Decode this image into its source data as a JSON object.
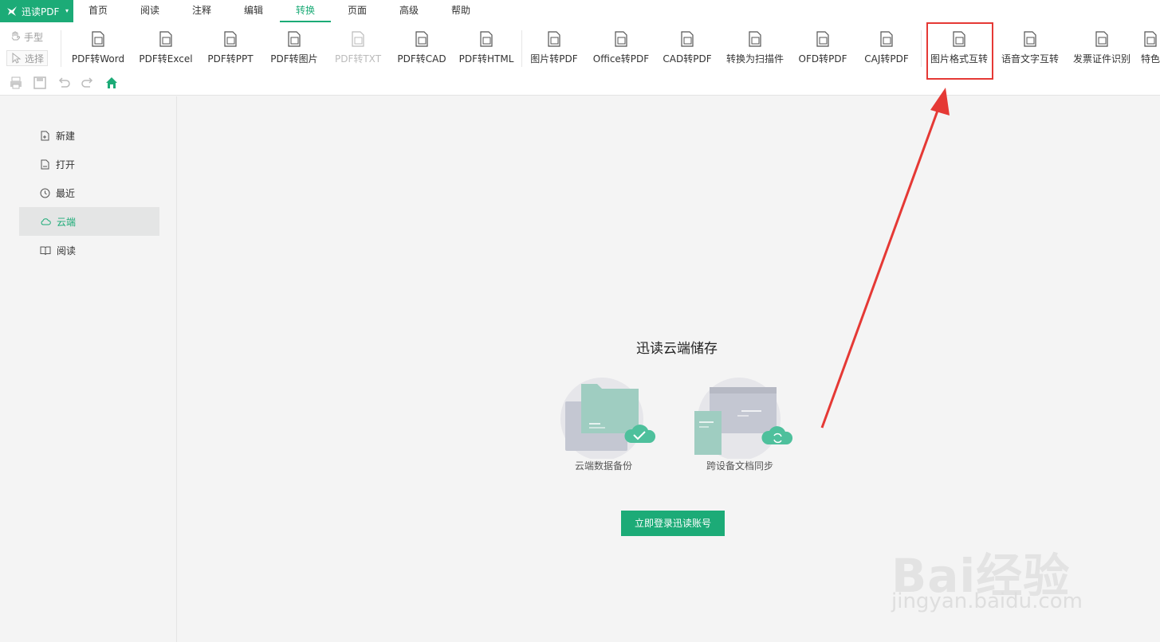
{
  "app": {
    "name": "迅读PDF"
  },
  "menu": [
    {
      "label": "首页"
    },
    {
      "label": "阅读"
    },
    {
      "label": "注释"
    },
    {
      "label": "编辑"
    },
    {
      "label": "转换"
    },
    {
      "label": "页面"
    },
    {
      "label": "高级"
    },
    {
      "label": "帮助"
    }
  ],
  "active_menu": "转换",
  "modes": {
    "hand": "手型",
    "select": "选择"
  },
  "tools": [
    {
      "label": "PDF转Word",
      "icon": "word-icon",
      "enabled": true
    },
    {
      "label": "PDF转Excel",
      "icon": "excel-icon",
      "enabled": true
    },
    {
      "label": "PDF转PPT",
      "icon": "ppt-icon",
      "enabled": true
    },
    {
      "label": "PDF转图片",
      "icon": "image-file-icon",
      "enabled": true
    },
    {
      "label": "PDF转TXT",
      "icon": "txt-icon",
      "enabled": false
    },
    {
      "label": "PDF转CAD",
      "icon": "cad-icon",
      "enabled": true
    },
    {
      "label": "PDF转HTML",
      "icon": "html-icon",
      "enabled": true
    },
    {
      "label": "图片转PDF",
      "icon": "pdf-icon",
      "enabled": true
    },
    {
      "label": "Office转PDF",
      "icon": "office-pdf-icon",
      "enabled": true
    },
    {
      "label": "CAD转PDF",
      "icon": "cad-pdf-icon",
      "enabled": true
    },
    {
      "label": "转换为扫描件",
      "icon": "scan-icon",
      "enabled": true
    },
    {
      "label": "OFD转PDF",
      "icon": "ofd-icon",
      "enabled": true
    },
    {
      "label": "CAJ转PDF",
      "icon": "caj-icon",
      "enabled": true
    },
    {
      "label": "图片格式互转",
      "icon": "image-convert-icon",
      "enabled": true
    },
    {
      "label": "语音文字互转",
      "icon": "voice-text-icon",
      "enabled": true
    },
    {
      "label": "发票证件识别",
      "icon": "invoice-scan-icon",
      "enabled": true
    },
    {
      "label": "特色",
      "icon": "feature-icon",
      "enabled": true
    }
  ],
  "sidebar": [
    {
      "label": "新建",
      "icon": "new-file-icon"
    },
    {
      "label": "打开",
      "icon": "open-file-icon"
    },
    {
      "label": "最近",
      "icon": "clock-icon"
    },
    {
      "label": "云端",
      "icon": "cloud-icon"
    },
    {
      "label": "阅读",
      "icon": "book-icon"
    }
  ],
  "active_sidebar": "云端",
  "cloud": {
    "title": "迅读云端储存",
    "features": [
      {
        "label": "云端数据备份"
      },
      {
        "label": "跨设备文档同步"
      }
    ],
    "login_button": "立即登录迅读账号"
  },
  "watermark": {
    "brand": "Bai经验",
    "url": "jingyan.baidu.com"
  },
  "colors": {
    "accent": "#1cab77",
    "highlight": "#e53935"
  }
}
